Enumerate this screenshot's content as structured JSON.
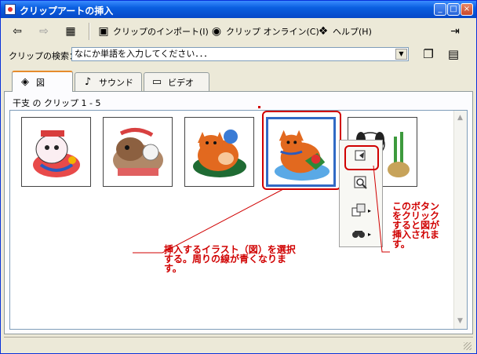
{
  "window": {
    "title": "クリップアートの挿入"
  },
  "titlebar_buttons": {
    "minimize": "_",
    "maximize": "□",
    "close": "×"
  },
  "toolbar": {
    "back_glyph": "⇦",
    "forward_glyph": "⇨",
    "grid_glyph": "▦",
    "import_label": "クリップのインポート(I)",
    "online_label": "クリップ オンライン(C)",
    "help_label": "ヘルプ(H)",
    "pin_glyph": "⇥"
  },
  "search": {
    "label": "クリップの検索：",
    "placeholder": "なにか単語を入力してください．．．",
    "dropdown_glyph": "▼"
  },
  "tabs": [
    {
      "label": "図",
      "glyph": "◈"
    },
    {
      "label": "サウンド",
      "glyph": "♪"
    },
    {
      "label": "ビデオ",
      "glyph": "▭"
    }
  ],
  "gallery": {
    "caption": "干支 の クリップ 1 - 5",
    "clips": [
      {
        "icon": "dog-figure-icon"
      },
      {
        "icon": "dog-charm-icon"
      },
      {
        "icon": "fox-figure-icon"
      },
      {
        "icon": "fox-figure-selected-icon"
      },
      {
        "icon": "dog-kadomatsu-icon"
      }
    ],
    "scroll_up": "▲",
    "scroll_down": "▼"
  },
  "popup": {
    "insert_icon": "insert-clip-icon",
    "preview_icon": "preview-icon",
    "copy_icon": "copy-icon",
    "find_icon": "find-similar-icon",
    "submenu_arrow": "▸"
  },
  "annotations": {
    "left": [
      "挿入するイラスト（図）を選択",
      "する。周りの線が青くなりま",
      "す。"
    ],
    "right": [
      "このボタン",
      "をクリック",
      "すると図が",
      "挿入されま",
      "す。"
    ]
  },
  "colors": {
    "titlebar": "#0a5fe0",
    "selection": "#316ac5",
    "annotation": "#d00000"
  }
}
